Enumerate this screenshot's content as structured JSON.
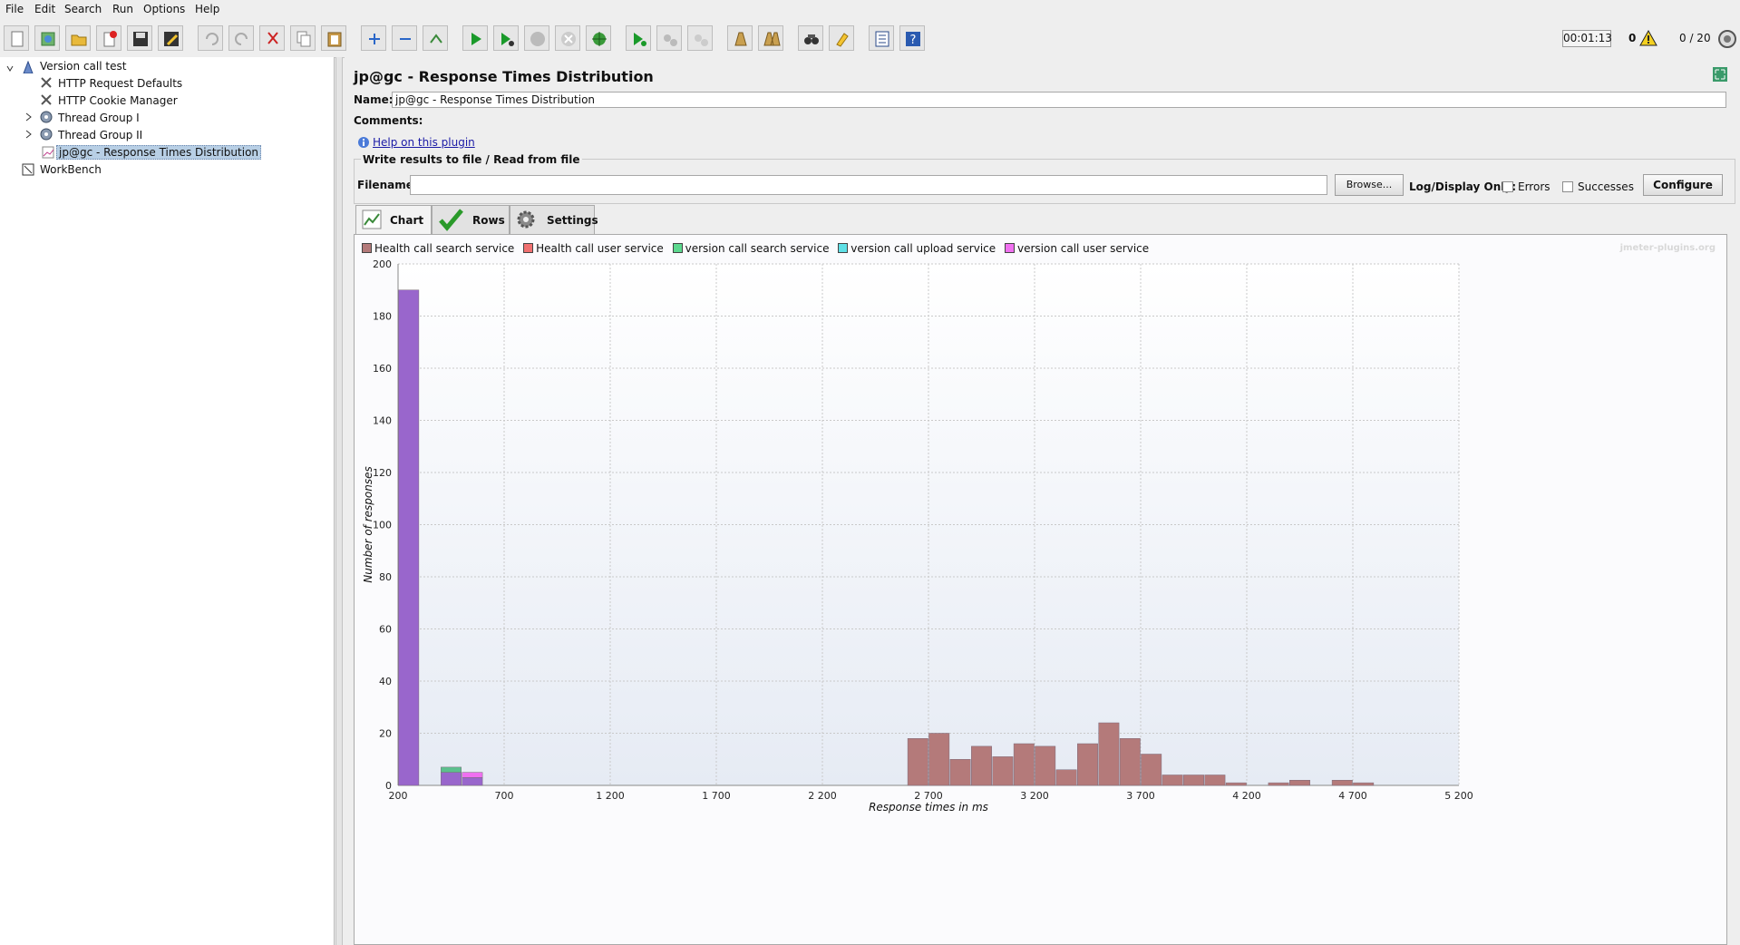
{
  "menu": [
    "File",
    "Edit",
    "Search",
    "Run",
    "Options",
    "Help"
  ],
  "status": {
    "timer": "00:01:13",
    "error_count": "0",
    "threads": "0 / 20"
  },
  "tree": {
    "root": "Version call test",
    "items": [
      "HTTP Request Defaults",
      "HTTP Cookie Manager",
      "Thread Group I",
      "Thread Group II",
      "jp@gc - Response Times Distribution"
    ],
    "workbench": "WorkBench"
  },
  "panel": {
    "title": "jp@gc - Response Times Distribution",
    "name_label": "Name:",
    "name_value": "jp@gc - Response Times Distribution",
    "comments_label": "Comments:",
    "help_link": "Help on this plugin",
    "file_legend": "Write results to file / Read from file",
    "filename_label": "Filename",
    "filename_value": "",
    "browse_label": "Browse...",
    "log_display_label": "Log/Display Only:",
    "errors_label": "Errors",
    "successes_label": "Successes",
    "configure_label": "Configure",
    "tabs": [
      "Chart",
      "Rows",
      "Settings"
    ],
    "watermark": "jmeter-plugins.org"
  },
  "colors": {
    "health_search": "#b47a7a",
    "health_user": "#f07070",
    "version_search": "#5cc08e",
    "version_upload": "#5ee0e6",
    "version_user": "#f070f0",
    "bar_main": "#9966cc"
  },
  "chart_data": {
    "type": "bar",
    "xlabel": "Response times in ms",
    "ylabel": "Number of responses",
    "xlim": [
      200,
      5200
    ],
    "ylim": [
      0,
      200
    ],
    "xticks": [
      200,
      700,
      1200,
      1700,
      2200,
      2700,
      3200,
      3700,
      4200,
      4700,
      5200
    ],
    "xtick_labels": [
      "200",
      "700",
      "1 200",
      "1 700",
      "2 200",
      "2 700",
      "3 200",
      "3 700",
      "4 200",
      "4 700",
      "5 200"
    ],
    "yticks": [
      0,
      20,
      40,
      60,
      80,
      100,
      120,
      140,
      160,
      180,
      200
    ],
    "legend": [
      "Health call search service",
      "Health call user service",
      "version call search service",
      "version call upload service",
      "version call user service"
    ],
    "bin_width": 100,
    "bars": [
      {
        "x": 200,
        "stack": [
          {
            "series": "merged",
            "value": 190
          }
        ]
      },
      {
        "x": 400,
        "stack": [
          {
            "series": "merged",
            "value": 5
          },
          {
            "series": "version call search service",
            "value": 2
          }
        ]
      },
      {
        "x": 500,
        "stack": [
          {
            "series": "merged",
            "value": 3
          },
          {
            "series": "version call user service",
            "value": 2
          }
        ]
      },
      {
        "x": 2600,
        "stack": [
          {
            "series": "Health call search service",
            "value": 18
          }
        ]
      },
      {
        "x": 2700,
        "stack": [
          {
            "series": "Health call search service",
            "value": 20
          }
        ]
      },
      {
        "x": 2800,
        "stack": [
          {
            "series": "Health call search service",
            "value": 10
          }
        ]
      },
      {
        "x": 2900,
        "stack": [
          {
            "series": "Health call search service",
            "value": 15
          }
        ]
      },
      {
        "x": 3000,
        "stack": [
          {
            "series": "Health call search service",
            "value": 11
          }
        ]
      },
      {
        "x": 3100,
        "stack": [
          {
            "series": "Health call search service",
            "value": 16
          }
        ]
      },
      {
        "x": 3200,
        "stack": [
          {
            "series": "Health call search service",
            "value": 15
          }
        ]
      },
      {
        "x": 3300,
        "stack": [
          {
            "series": "Health call search service",
            "value": 6
          }
        ]
      },
      {
        "x": 3400,
        "stack": [
          {
            "series": "Health call search service",
            "value": 16
          }
        ]
      },
      {
        "x": 3500,
        "stack": [
          {
            "series": "Health call search service",
            "value": 24
          }
        ]
      },
      {
        "x": 3600,
        "stack": [
          {
            "series": "Health call search service",
            "value": 18
          }
        ]
      },
      {
        "x": 3700,
        "stack": [
          {
            "series": "Health call search service",
            "value": 12
          }
        ]
      },
      {
        "x": 3800,
        "stack": [
          {
            "series": "Health call search service",
            "value": 4
          }
        ]
      },
      {
        "x": 3900,
        "stack": [
          {
            "series": "Health call search service",
            "value": 4
          }
        ]
      },
      {
        "x": 4000,
        "stack": [
          {
            "series": "Health call search service",
            "value": 4
          }
        ]
      },
      {
        "x": 4100,
        "stack": [
          {
            "series": "Health call search service",
            "value": 1
          }
        ]
      },
      {
        "x": 4300,
        "stack": [
          {
            "series": "Health call search service",
            "value": 1
          }
        ]
      },
      {
        "x": 4400,
        "stack": [
          {
            "series": "Health call search service",
            "value": 2
          }
        ]
      },
      {
        "x": 4600,
        "stack": [
          {
            "series": "Health call search service",
            "value": 2
          }
        ]
      },
      {
        "x": 4700,
        "stack": [
          {
            "series": "Health call search service",
            "value": 1
          }
        ]
      }
    ]
  }
}
